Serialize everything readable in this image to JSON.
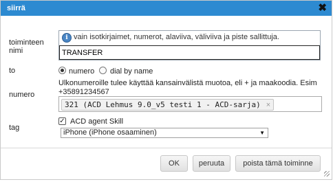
{
  "dialog": {
    "title": "siirrä",
    "close_icon": "close-x-icon"
  },
  "fields": {
    "name": {
      "label": "toiminteen nimi",
      "info_icon": "info-icon",
      "info_text": "vain isotkirjaimet, numerot, alaviiva, väliviiva ja piste sallittuja.",
      "value": "TRANSFER"
    },
    "to": {
      "label": "to",
      "options": [
        "numero",
        "dial by name"
      ],
      "selected": "numero"
    },
    "numero": {
      "label": "numero",
      "help": "Ulkonumeroille tulee käyttää kansainvälistä muotoa, eli + ja maakoodia. Esim +35891234567",
      "chip": "321 (ACD Lehmus 9.0_v5 testi 1 - ACD-sarja)",
      "chip_remove": "×"
    },
    "tag": {
      "label": "tag",
      "checkbox_label": "ACD agent Skill",
      "checked": true,
      "select_value": "iPhone (iPhone osaaminen)"
    }
  },
  "buttons": {
    "ok": "OK",
    "cancel": "peruuta",
    "delete": "poista tämä toiminne"
  }
}
